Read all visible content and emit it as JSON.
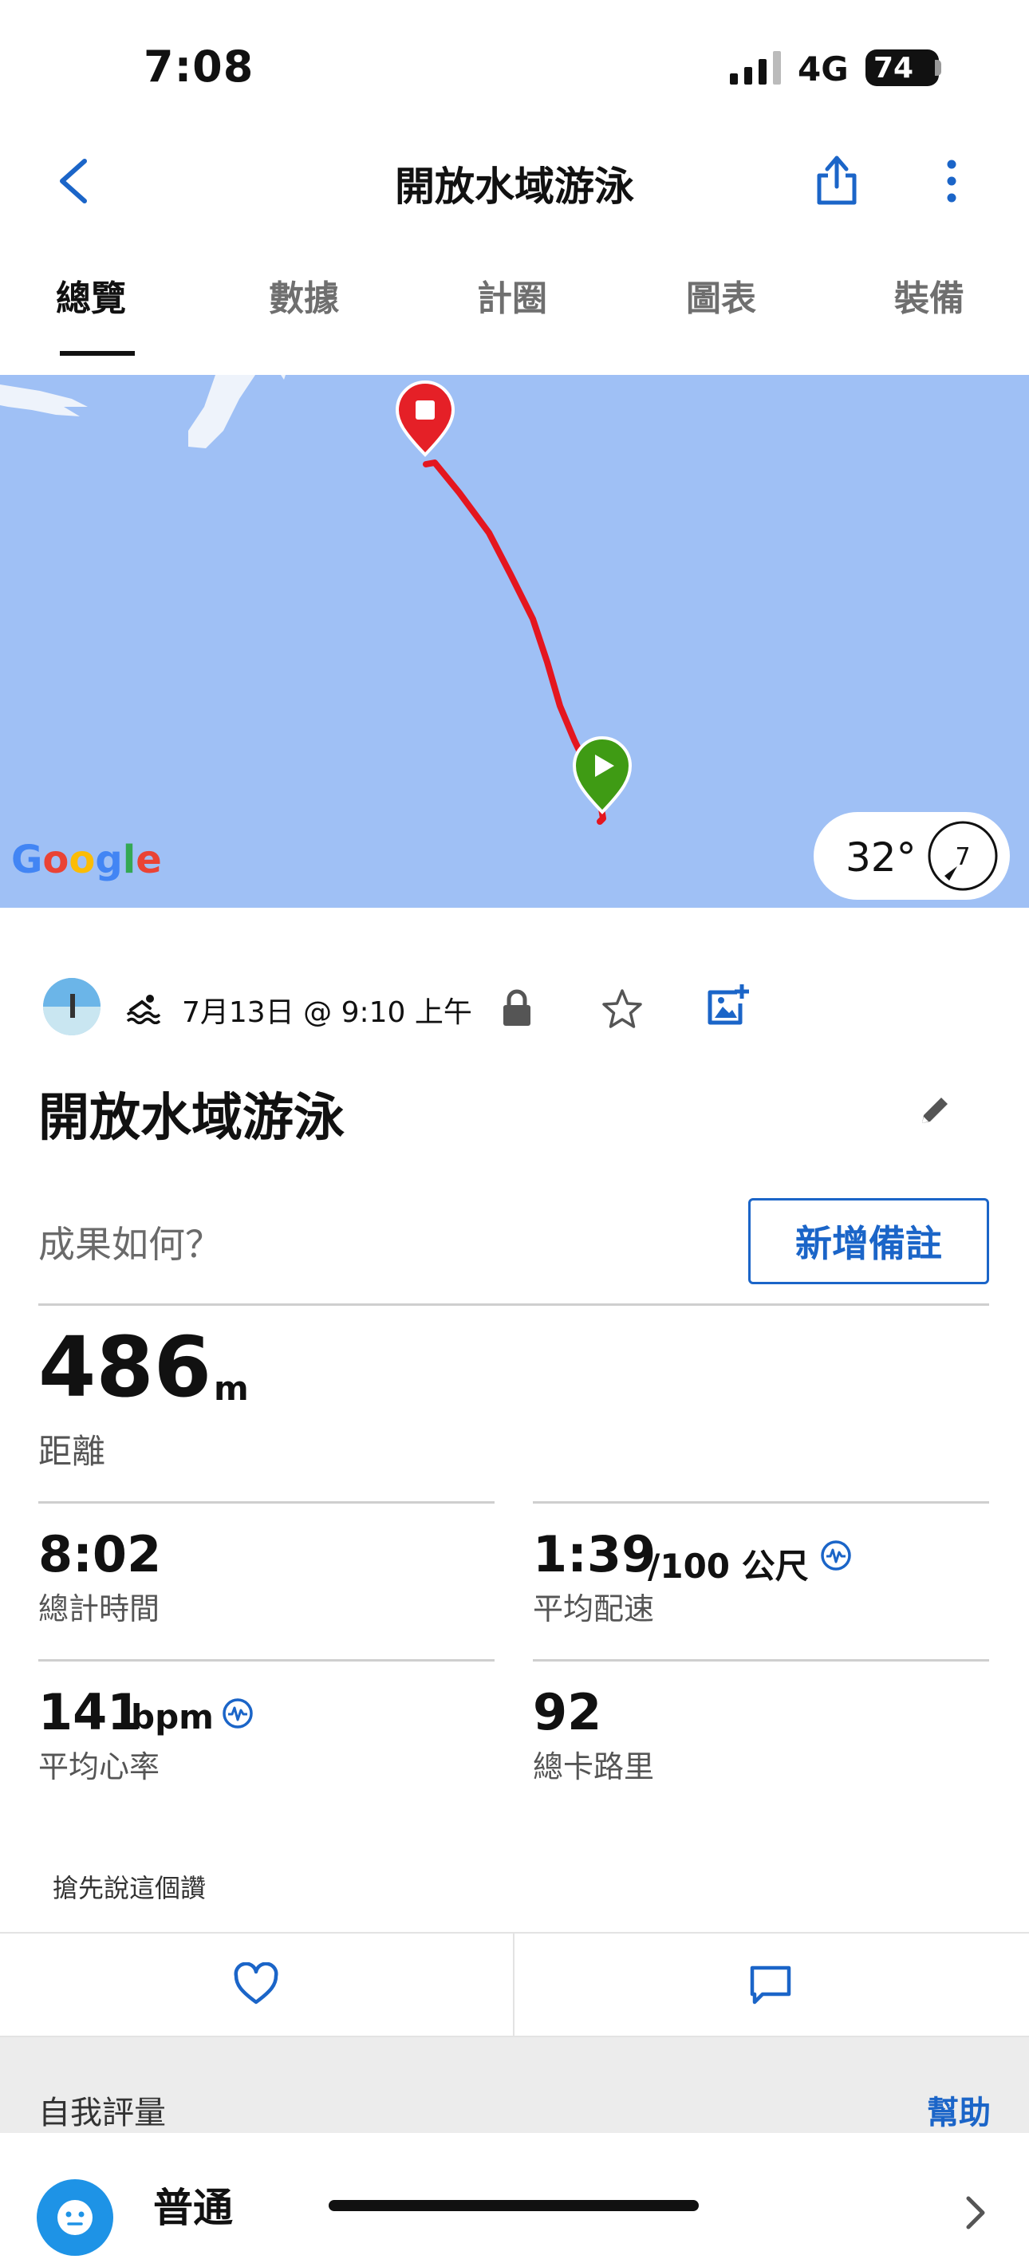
{
  "status_bar": {
    "time": "7:08",
    "network": "4G",
    "battery": "74"
  },
  "header": {
    "title": "開放水域游泳"
  },
  "tabs": [
    {
      "label": "總覽"
    },
    {
      "label": "數據"
    },
    {
      "label": "計圈"
    },
    {
      "label": "圖表"
    },
    {
      "label": "裝備"
    }
  ],
  "map": {
    "temperature": "32°",
    "wind_value": "7",
    "google_logo": "Google"
  },
  "activity": {
    "date": "7月13日 @ 9:10 上午",
    "title": "開放水域游泳",
    "how_prompt": "成果如何？",
    "add_note_label": "新增備註"
  },
  "stats": {
    "distance": {
      "value": "486",
      "unit": "m",
      "label": "距離"
    },
    "total_time": {
      "value": "8:02",
      "label": "總計時間"
    },
    "avg_pace": {
      "value": "1:39",
      "unit": "/100 公尺",
      "label": "平均配速"
    },
    "avg_hr": {
      "value": "141",
      "unit": "bpm",
      "label": "平均心率"
    },
    "calories": {
      "value": "92",
      "label": "總卡路里"
    }
  },
  "social": {
    "first_like": "搶先說這個讚"
  },
  "self_eval": {
    "label": "自我評量",
    "help": "幫助",
    "value": "普通"
  }
}
